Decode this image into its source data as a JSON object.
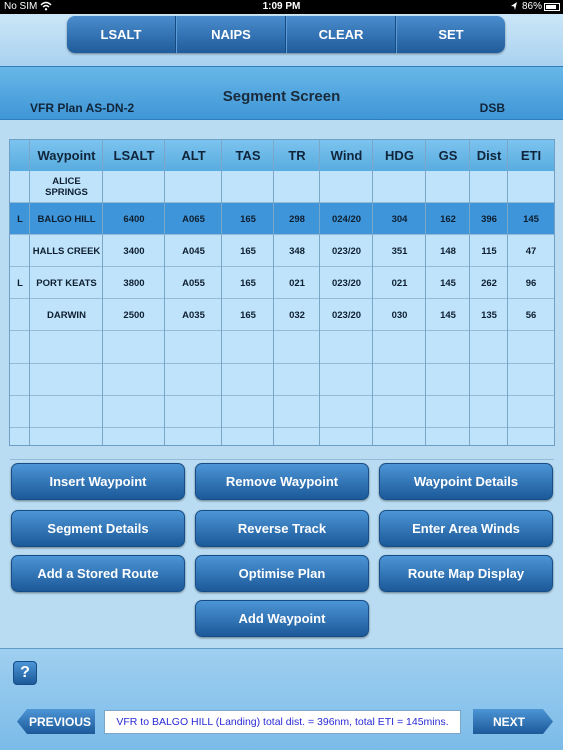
{
  "status_bar": {
    "carrier": "No SIM",
    "time": "1:09 PM",
    "battery": "86%",
    "battery_level": 0.86
  },
  "toolbar": {
    "items": [
      "LSALT",
      "NAIPS",
      "CLEAR",
      "SET"
    ]
  },
  "header": {
    "title": "Segment Screen",
    "plan": "VFR Plan AS-DN-2",
    "crew": "DSB"
  },
  "table": {
    "columns": [
      "",
      "Waypoint",
      "LSALT",
      "ALT",
      "TAS",
      "TR",
      "Wind",
      "HDG",
      "GS",
      "Dist",
      "ETI"
    ],
    "rows": [
      [
        "",
        "ALICE SPRINGS",
        "",
        "",
        "",
        "",
        "",
        "",
        "",
        "",
        ""
      ],
      [
        "L",
        "BALGO HILL",
        "6400",
        "A065",
        "165",
        "298",
        "024/20",
        "304",
        "162",
        "396",
        "145"
      ],
      [
        "",
        "HALLS CREEK",
        "3400",
        "A045",
        "165",
        "348",
        "023/20",
        "351",
        "148",
        "115",
        "47"
      ],
      [
        "L",
        "PORT KEATS",
        "3800",
        "A055",
        "165",
        "021",
        "023/20",
        "021",
        "145",
        "262",
        "96"
      ],
      [
        "",
        "DARWIN",
        "2500",
        "A035",
        "165",
        "032",
        "023/20",
        "030",
        "145",
        "135",
        "56"
      ]
    ],
    "selected_row": 1
  },
  "buttons": {
    "insert_waypoint": "Insert Waypoint",
    "remove_waypoint": "Remove Waypoint",
    "waypoint_details": "Waypoint Details",
    "segment_details": "Segment Details",
    "reverse_track": "Reverse Track",
    "enter_area_winds": "Enter Area Winds",
    "add_stored_route": "Add a Stored Route",
    "optimise_plan": "Optimise Plan",
    "route_map_display": "Route Map Display",
    "add_waypoint": "Add Waypoint"
  },
  "footer": {
    "help": "?",
    "previous": "PREVIOUS",
    "next": "NEXT",
    "message": "VFR to BALGO HILL (Landing) total dist. = 396nm, total ETI = 145mins."
  }
}
